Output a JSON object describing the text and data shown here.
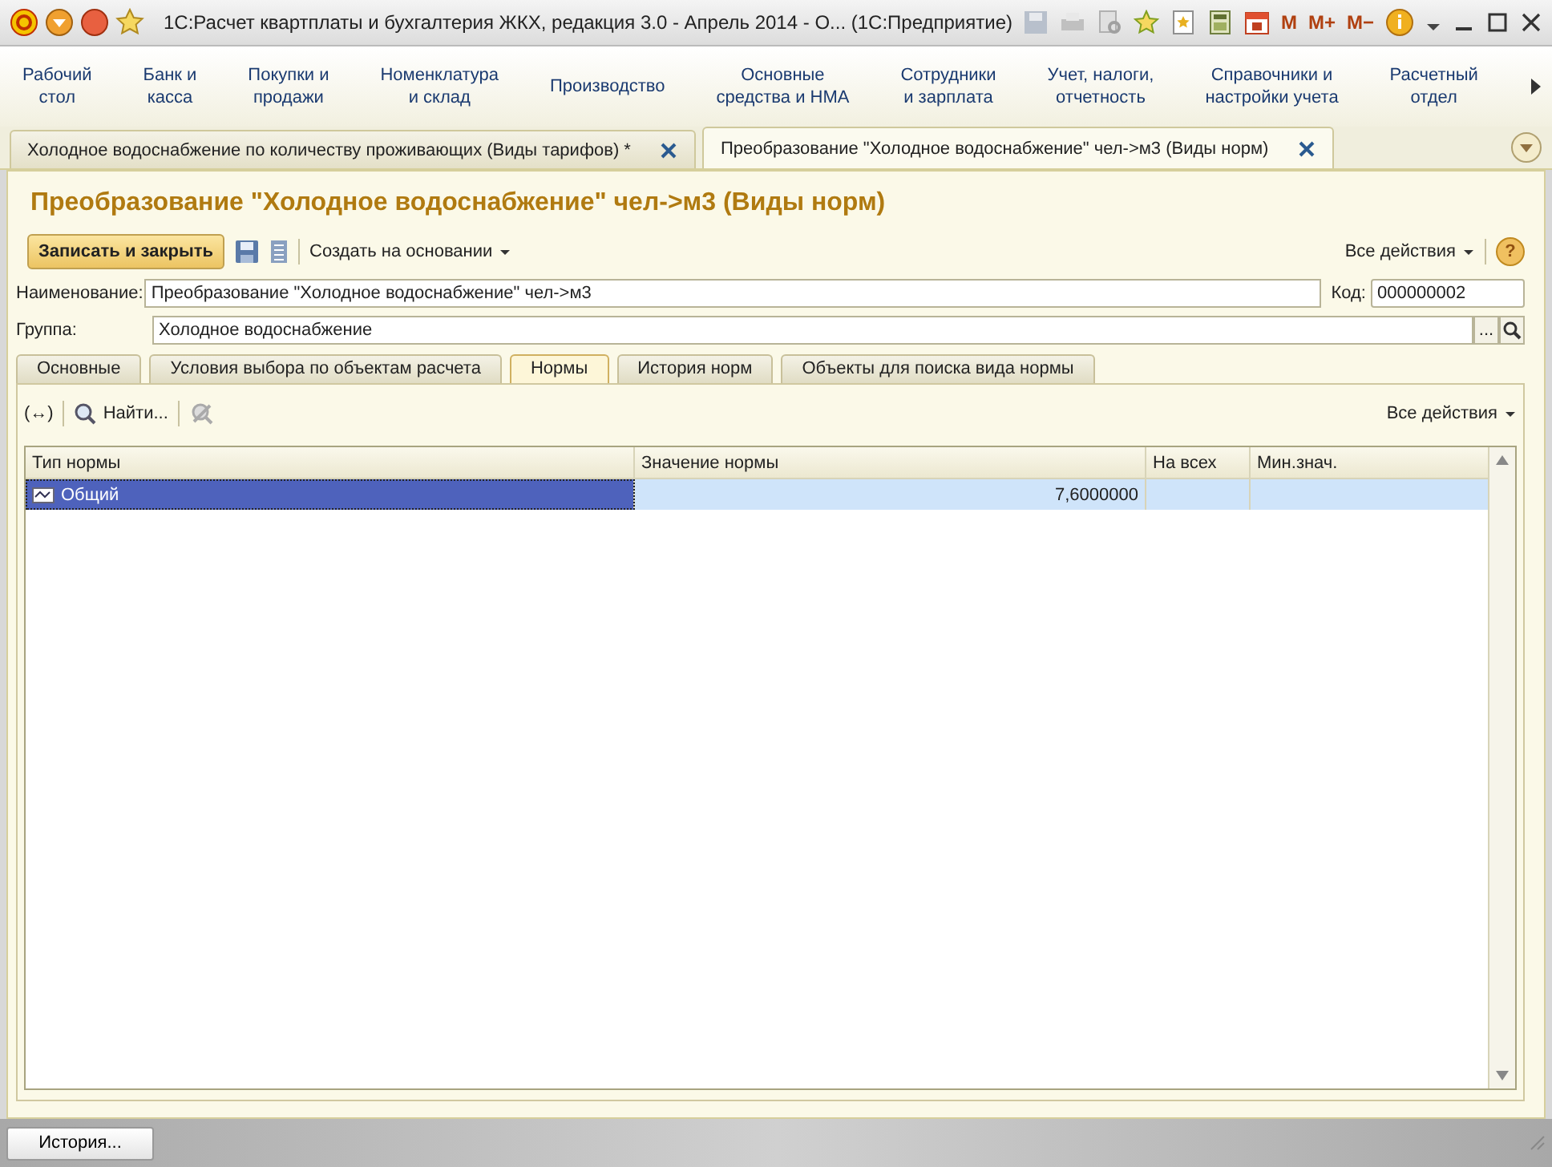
{
  "window": {
    "title": "1С:Расчет квартплаты и бухгалтерия ЖКХ, редакция 3.0 - Апрель 2014 - О...  (1С:Предприятие)",
    "memory_keys": [
      "M",
      "M+",
      "M−"
    ]
  },
  "sections": [
    {
      "label": "Рабочий\nстол"
    },
    {
      "label": "Банк и\nкасса"
    },
    {
      "label": "Покупки и\nпродажи"
    },
    {
      "label": "Номенклатура\nи склад"
    },
    {
      "label": "Производство"
    },
    {
      "label": "Основные\nсредства и НМА"
    },
    {
      "label": "Сотрудники\nи зарплата"
    },
    {
      "label": "Учет, налоги,\nотчетность"
    },
    {
      "label": "Справочники и\nнастройки учета"
    },
    {
      "label": "Расчетный\nотдел"
    }
  ],
  "open_tabs": [
    {
      "label": "Холодное водоснабжение по количеству проживающих (Виды тарифов) *",
      "selected": false
    },
    {
      "label": "Преобразование \"Холодное водоснабжение\" чел->м3 (Виды норм)",
      "selected": true
    }
  ],
  "form": {
    "title": "Преобразование \"Холодное водоснабжение\" чел->м3 (Виды норм)",
    "toolbar": {
      "save_close": "Записать и закрыть",
      "create_based_on": "Создать на основании",
      "all_actions": "Все действия",
      "help": "?"
    },
    "name": {
      "label": "Наименование:",
      "value": "Преобразование \"Холодное водоснабжение\" чел->м3"
    },
    "code": {
      "label": "Код:",
      "value": "000000002"
    },
    "group": {
      "label": "Группа:",
      "value": "Холодное водоснабжение",
      "choose": "..."
    },
    "tabs": [
      {
        "label": "Основные",
        "selected": false
      },
      {
        "label": "Условия выбора по объектам расчета",
        "selected": false
      },
      {
        "label": "Нормы",
        "selected": true
      },
      {
        "label": "История норм",
        "selected": false
      },
      {
        "label": "Объекты для поиска вида нормы",
        "selected": false
      }
    ],
    "table_toolbar": {
      "expand": "(↔)",
      "find": "Найти...",
      "all_actions": "Все действия"
    },
    "table": {
      "columns": [
        "Тип нормы",
        "Значение нормы",
        "На всех",
        "Мин.знач."
      ],
      "rows": [
        {
          "cells": [
            "Общий",
            "7,6000000",
            "",
            ""
          ],
          "selected": true
        }
      ]
    }
  },
  "status_bar": {
    "history": "История..."
  }
}
